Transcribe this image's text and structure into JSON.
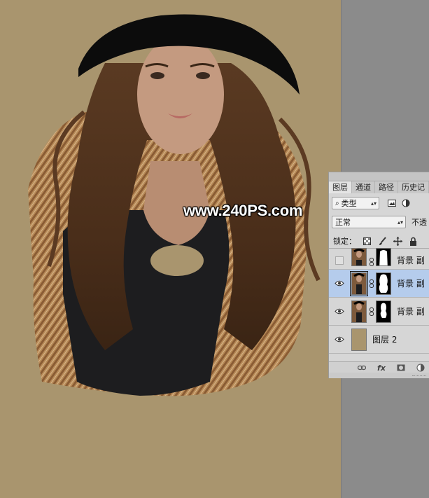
{
  "canvas": {
    "background_color": "#a9956e",
    "watermark": "www.240PS.com"
  },
  "layers_panel": {
    "tabs": [
      "图层",
      "通道",
      "路径",
      "历史记"
    ],
    "active_tab": "图层",
    "filter": {
      "icon": "search-icon",
      "value": "类型"
    },
    "blend_mode": "正常",
    "opacity_label": "不透",
    "lock_label": "锁定：",
    "layers": [
      {
        "name": "背景 副",
        "visible": false,
        "selected": false,
        "has_mask": true
      },
      {
        "name": "背景 副",
        "visible": true,
        "selected": true,
        "has_mask": true
      },
      {
        "name": "背景 副",
        "visible": true,
        "selected": false,
        "has_mask": true
      },
      {
        "name": "图层 2",
        "visible": true,
        "selected": false,
        "has_mask": false
      }
    ],
    "footer_icons": [
      "link-icon",
      "fx-icon",
      "add-mask-icon",
      "adjustment-icon"
    ],
    "fx_label": "fx"
  }
}
